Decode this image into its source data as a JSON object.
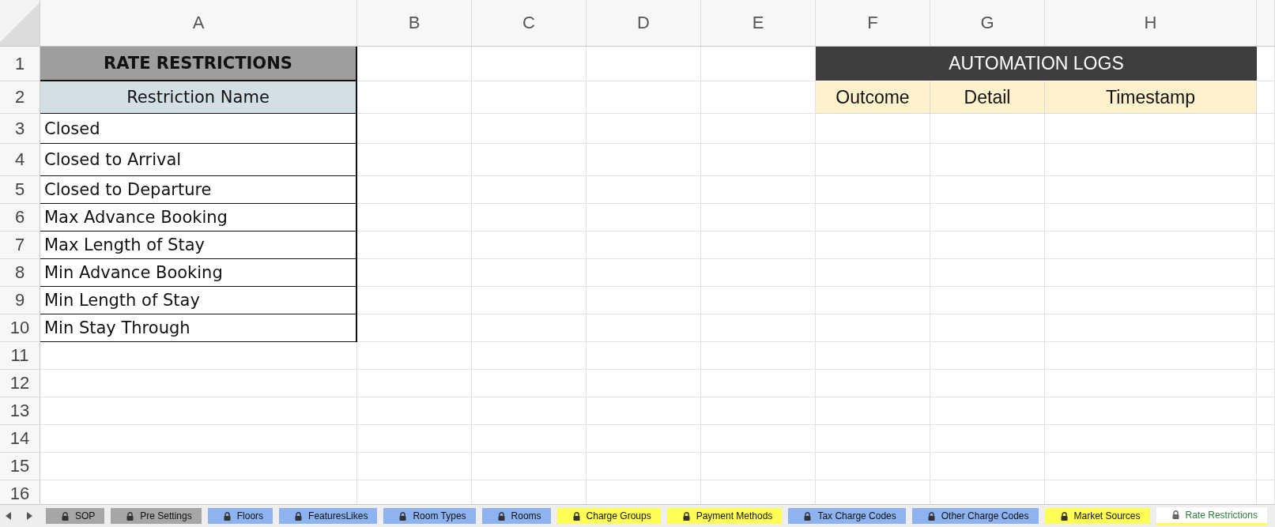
{
  "columns": [
    "A",
    "B",
    "C",
    "D",
    "E",
    "F",
    "G",
    "H"
  ],
  "rows": [
    "1",
    "2",
    "3",
    "4",
    "5",
    "6",
    "7",
    "8",
    "9",
    "10",
    "11",
    "12",
    "13",
    "14",
    "15",
    "16"
  ],
  "restrictions_table": {
    "title": "RATE RESTRICTIONS",
    "header": "Restriction Name",
    "items": [
      "Closed",
      "Closed to Arrival",
      "Closed to Departure",
      "Max Advance Booking",
      "Max Length of Stay",
      "Min Advance Booking",
      "Min Length of Stay",
      "Min Stay Through"
    ]
  },
  "automation_logs": {
    "title": "AUTOMATION LOGS",
    "headers": [
      "Outcome",
      "Detail",
      "Timestamp"
    ]
  },
  "sheet_tabs": [
    {
      "label": "SOP",
      "color": "#a6a6a6",
      "selected": false
    },
    {
      "label": "Pre Settings",
      "color": "#a6a6a6",
      "selected": false
    },
    {
      "label": "Floors",
      "color": "#8db4f0",
      "selected": false
    },
    {
      "label": "FeaturesLikes",
      "color": "#8db4f0",
      "selected": false
    },
    {
      "label": "Room Types",
      "color": "#8db4f0",
      "selected": false
    },
    {
      "label": "Rooms",
      "color": "#8db4f0",
      "selected": false
    },
    {
      "label": "Charge Groups",
      "color": "#ffff55",
      "selected": false
    },
    {
      "label": "Payment Methods",
      "color": "#ffff55",
      "selected": false
    },
    {
      "label": "Tax Charge Codes",
      "color": "#8db4f0",
      "selected": false
    },
    {
      "label": "Other Charge Codes",
      "color": "#8db4f0",
      "selected": false
    },
    {
      "label": "Market Sources",
      "color": "#ffff55",
      "selected": false
    },
    {
      "label": "Rate Restrictions",
      "color": "#ffff55",
      "selected": true
    }
  ]
}
